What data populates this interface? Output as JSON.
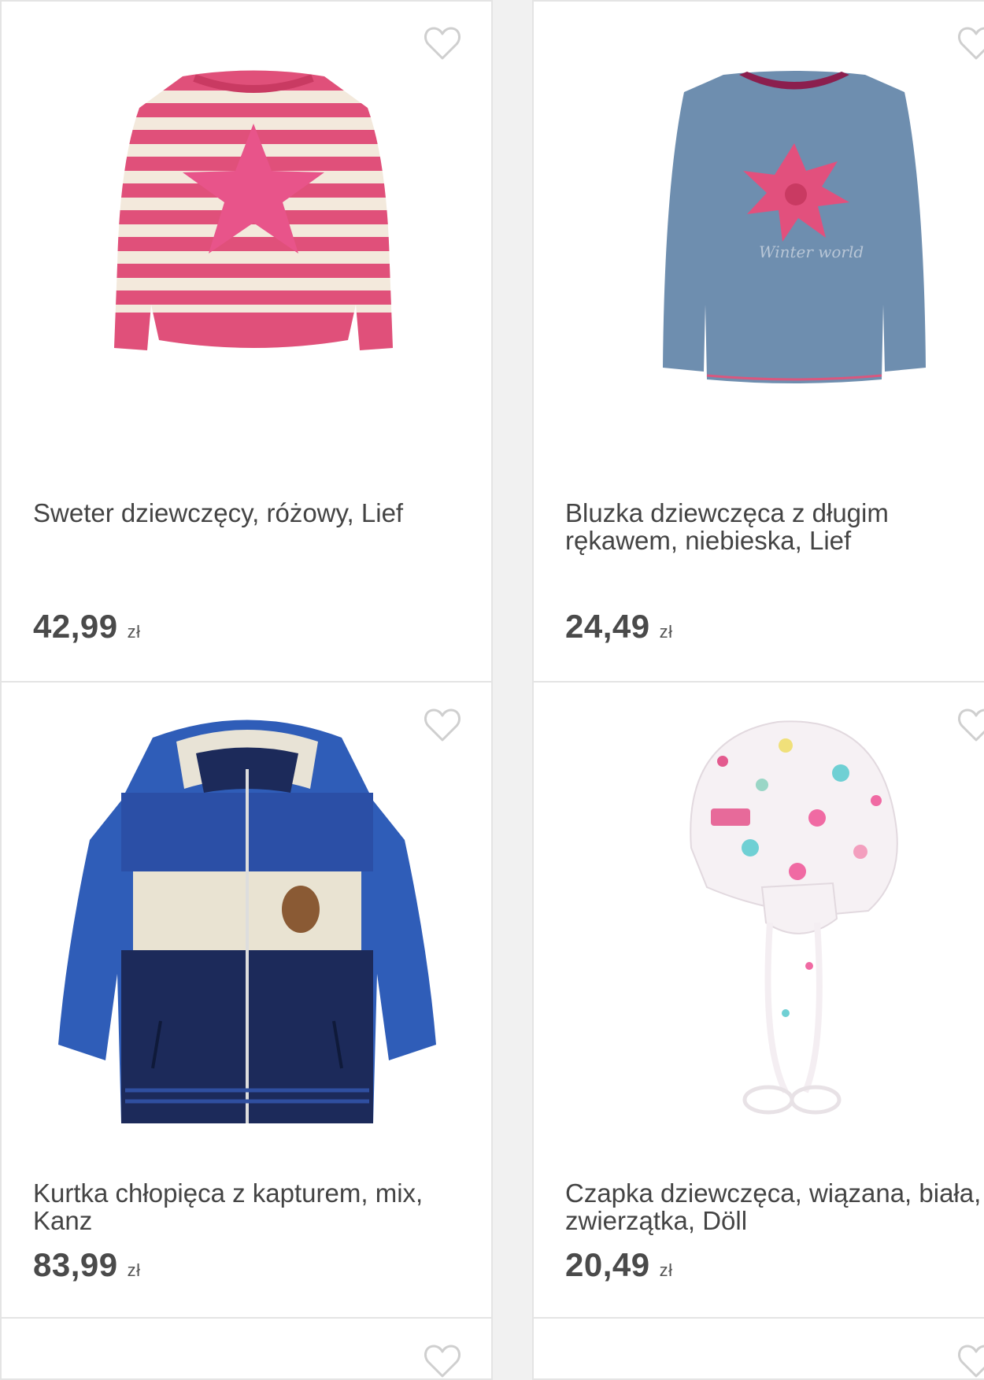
{
  "products": [
    {
      "title": "Sweter dziewczęcy, różowy, Lief",
      "price": "42,99",
      "currency": "zł",
      "image": "pink-striped-sweater",
      "icon": "heart-icon"
    },
    {
      "title": "Bluzka dziewczęca z długim rękawem, niebieska, Lief",
      "price": "24,49",
      "currency": "zł",
      "image": "blue-long-sleeve-top",
      "icon": "heart-icon"
    },
    {
      "title": "Kurtka chłopięca z kapturem, mix, Kanz",
      "price": "83,99",
      "currency": "zł",
      "image": "blue-hooded-jacket",
      "icon": "heart-icon"
    },
    {
      "title": "Czapka dziewczęca, wiązana, biała, zwierzątka, Döll",
      "price": "20,49",
      "currency": "zł",
      "image": "white-patterned-cap",
      "icon": "heart-icon"
    }
  ],
  "colors": {
    "background": "#f1f1f1",
    "card": "#ffffff",
    "border": "#e4e4e4",
    "heart_outline": "#cfcfcf",
    "text": "#444444"
  }
}
